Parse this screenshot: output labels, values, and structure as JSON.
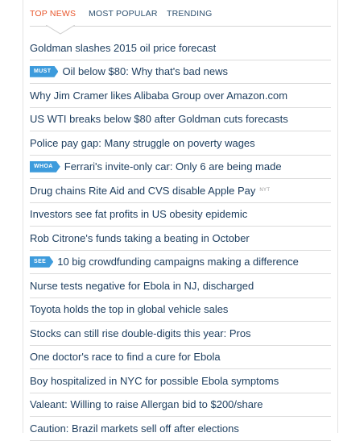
{
  "tabs": [
    {
      "label": "TOP NEWS",
      "active": true
    },
    {
      "label": "MOST POPULAR",
      "active": false
    },
    {
      "label": "TRENDING",
      "active": false
    }
  ],
  "colors": {
    "active_tab": "#e8562c",
    "tab_text": "#2c4f6e",
    "headline_text": "#1c3d5e",
    "badge_bg": "#3d9bdc"
  },
  "headlines": [
    {
      "text": "Goldman slashes 2015 oil price forecast"
    },
    {
      "badge": "MUST",
      "text": "Oil below $80: Why that's bad news"
    },
    {
      "text": "Why Jim Cramer likes Alibaba Group over Amazon.com"
    },
    {
      "text": "US WTI breaks below $80 after Goldman cuts forecasts"
    },
    {
      "text": "Police pay gap: Many struggle on poverty wages"
    },
    {
      "badge": "WHOA",
      "text": "Ferrari's invite-only car: Only 6 are being made"
    },
    {
      "text": "Drug chains Rite Aid and CVS disable Apple Pay",
      "source": "NYT"
    },
    {
      "text": "Investors see fat profits in US obesity epidemic"
    },
    {
      "text": "Rob Citrone's funds taking a beating in October"
    },
    {
      "badge": "SEE",
      "text": "10 big crowdfunding campaigns making a difference"
    },
    {
      "text": "Nurse tests negative for Ebola in NJ, discharged"
    },
    {
      "text": "Toyota holds the top in global vehicle sales"
    },
    {
      "text": "Stocks can still rise double-digits this year: Pros"
    },
    {
      "text": "One doctor's race to find a cure for Ebola"
    },
    {
      "text": "Boy hospitalized in NYC for possible Ebola symptoms"
    },
    {
      "text": "Valeant: Willing to raise Allergan bid to $200/share"
    },
    {
      "text": "Caution: Brazil markets sell off after elections"
    }
  ]
}
